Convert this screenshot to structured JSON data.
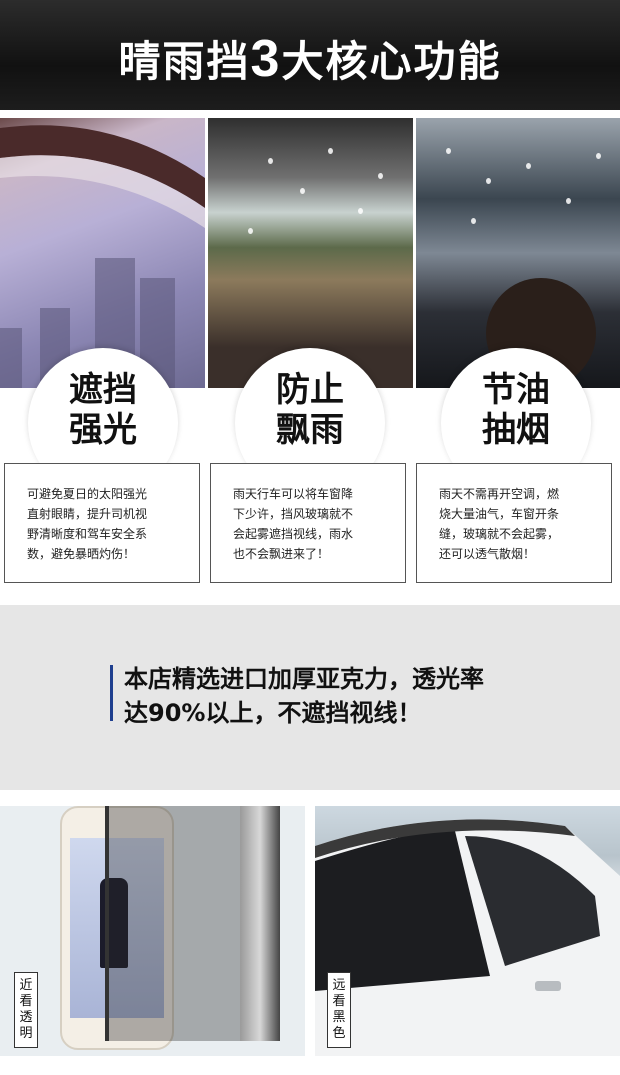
{
  "header": {
    "title_prefix": "晴雨挡",
    "title_number": "3",
    "title_suffix": "大核心功能"
  },
  "features": [
    {
      "title_line1": "遮挡",
      "title_line2": "强光",
      "desc": [
        "可避免夏日的太阳强光",
        "直射眼睛，提升司机视",
        "野清晰度和驾车安全系",
        "数，避免暴晒灼伤！"
      ]
    },
    {
      "title_line1": "防止",
      "title_line2": "飘雨",
      "desc": [
        "雨天行车可以将车窗降",
        "下少许，挡风玻璃就不",
        "会起雾遮挡视线，雨水",
        "也不会飘进来了！"
      ]
    },
    {
      "title_line1": "节油",
      "title_line2": "抽烟",
      "desc": [
        "雨天不需再开空调，燃",
        "烧大量油气，车窗开条",
        "缝，玻璃就不会起雾，",
        "还可以透气散烟！"
      ]
    }
  ],
  "banner": {
    "line1": "本店精选进口加厚亚克力，透光率",
    "line2": "达90%以上，不遮挡视线！",
    "accent": "#1f3f8f"
  },
  "bottom": {
    "left_label": [
      "近",
      "看",
      "透",
      "明"
    ],
    "right_label": [
      "远",
      "看",
      "黑",
      "色"
    ]
  },
  "colors": {
    "header_bg": "#1a1a1a",
    "header_text": "#ffffff",
    "banner_bg": "#e6e6e6"
  }
}
